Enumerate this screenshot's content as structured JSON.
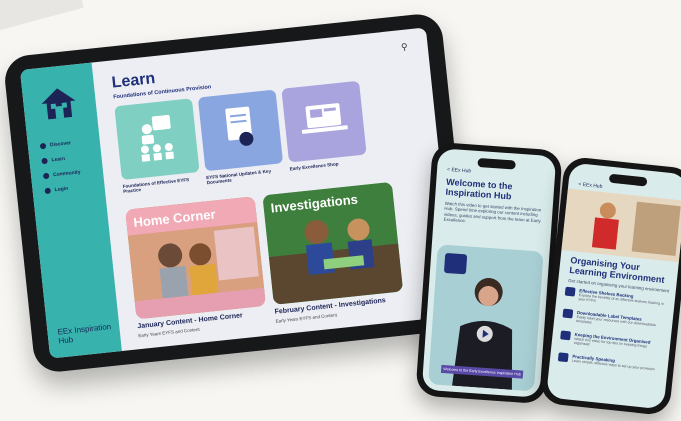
{
  "tablet": {
    "search_icon": "search-icon",
    "sidebar": {
      "items": [
        {
          "label": "Discover"
        },
        {
          "label": "Learn"
        },
        {
          "label": "Community"
        },
        {
          "label": "Login"
        }
      ],
      "brand": "EEx Inspiration Hub"
    },
    "title": "Learn",
    "subtitle": "Foundations of Continuous Provision",
    "cards": [
      {
        "label": "Foundations of Effective EYFS Practice",
        "color": "#7fd0c2"
      },
      {
        "label": "EYFS National Updates & Key Documents",
        "color": "#8aa6e0"
      },
      {
        "label": "Early Excellence Shop",
        "color": "#a9a3de"
      }
    ],
    "features": [
      {
        "header": "Home Corner",
        "caption": "January Content - Home Corner",
        "sub": "Early Years EYFS and Content",
        "head_color": "#f1a9b6"
      },
      {
        "header": "Investigations",
        "caption": "February Content - Investigations",
        "sub": "Early Years EYFS and Content",
        "head_color": "#4b9a4e"
      }
    ]
  },
  "phone1": {
    "back": "< EEx Hub",
    "title": "Welcome to the Inspiration Hub",
    "text": "Watch this video to get started with the Inspiration Hub. Spend time exploring our content including videos, guides and support from the team at Early Excellence.",
    "video_caption": "Welcome to the Early Excellence Inspiration Hub"
  },
  "phone2": {
    "back": "< EEx Hub",
    "title": "Organising Your Learning Environment",
    "intro": "Get started on organising your learning environment",
    "rows": [
      {
        "title": "Effective Shelves Backing",
        "desc": "Explore the benefits of an effective shelves backing in your EYFS"
      },
      {
        "title": "Downloadable Label Templates",
        "desc": "Easily label your resources with our downloadable templates"
      },
      {
        "title": "Keeping the Environment Organised",
        "desc": "Watch this video for top tips on keeping things organised"
      },
      {
        "title": "Practically Speaking",
        "desc": "Learn simple, effective ways to set up your provision"
      }
    ]
  }
}
